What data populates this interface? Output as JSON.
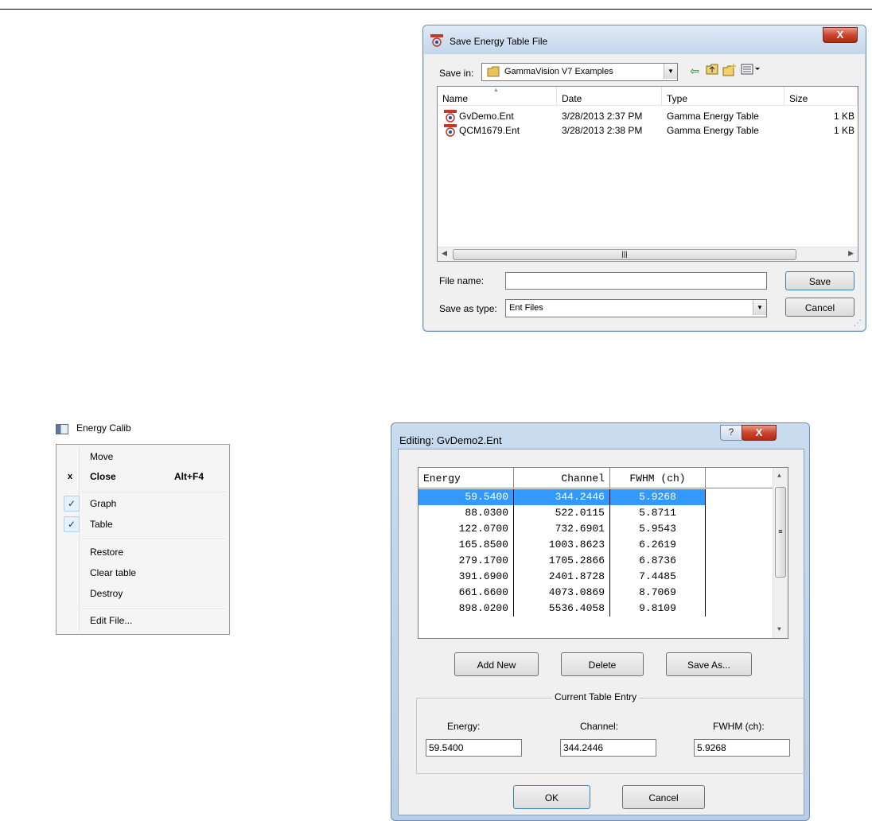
{
  "save_dialog": {
    "title": "Save Energy Table File",
    "close_glyph": "X",
    "save_in_label": "Save in:",
    "save_in_value": "GammaVision V7 Examples",
    "columns": [
      "Name",
      "Date",
      "Type",
      "Size"
    ],
    "files": [
      {
        "name": "GvDemo.Ent",
        "date": "3/28/2013 2:37 PM",
        "type": "Gamma Energy Table",
        "size": "1 KB"
      },
      {
        "name": "QCM1679.Ent",
        "date": "3/28/2013 2:38 PM",
        "type": "Gamma Energy Table",
        "size": "1 KB"
      }
    ],
    "file_name_label": "File name:",
    "file_name_value": "",
    "save_as_type_label": "Save as type:",
    "save_as_type_value": "Ent Files",
    "save_button": "Save",
    "cancel_button": "Cancel"
  },
  "context_menu": {
    "title": "Energy Calib",
    "items": {
      "move": "Move",
      "close": "Close",
      "close_mark": "x",
      "close_shortcut": "Alt+F4",
      "graph": "Graph",
      "table": "Table",
      "restore": "Restore",
      "clear_table": "Clear table",
      "destroy": "Destroy",
      "edit_file": "Edit File..."
    },
    "check_glyph": "✓"
  },
  "edit_dialog": {
    "title": "Editing: GvDemo2.Ent",
    "help_glyph": "?",
    "close_glyph": "X",
    "columns": [
      "Energy",
      "Channel",
      "FWHM (ch)"
    ],
    "rows": [
      [
        "59.5400",
        "344.2446",
        "5.9268"
      ],
      [
        "88.0300",
        "522.0115",
        "5.8711"
      ],
      [
        "122.0700",
        "732.6901",
        "5.9543"
      ],
      [
        "165.8500",
        "1003.8623",
        "6.2619"
      ],
      [
        "279.1700",
        "1705.2866",
        "6.8736"
      ],
      [
        "391.6900",
        "2401.8728",
        "7.4485"
      ],
      [
        "661.6600",
        "4073.0869",
        "8.7069"
      ],
      [
        "898.0200",
        "5536.4058",
        "9.8109"
      ]
    ],
    "add_new_button": "Add New",
    "delete_button": "Delete",
    "save_as_button": "Save As...",
    "group_label": "Current Table Entry",
    "energy_label": "Energy:",
    "channel_label": "Channel:",
    "fwhm_label": "FWHM (ch):",
    "energy_value": "59.5400",
    "channel_value": "344.2446",
    "fwhm_value": "5.9268",
    "ok_button": "OK",
    "cancel_button": "Cancel"
  }
}
